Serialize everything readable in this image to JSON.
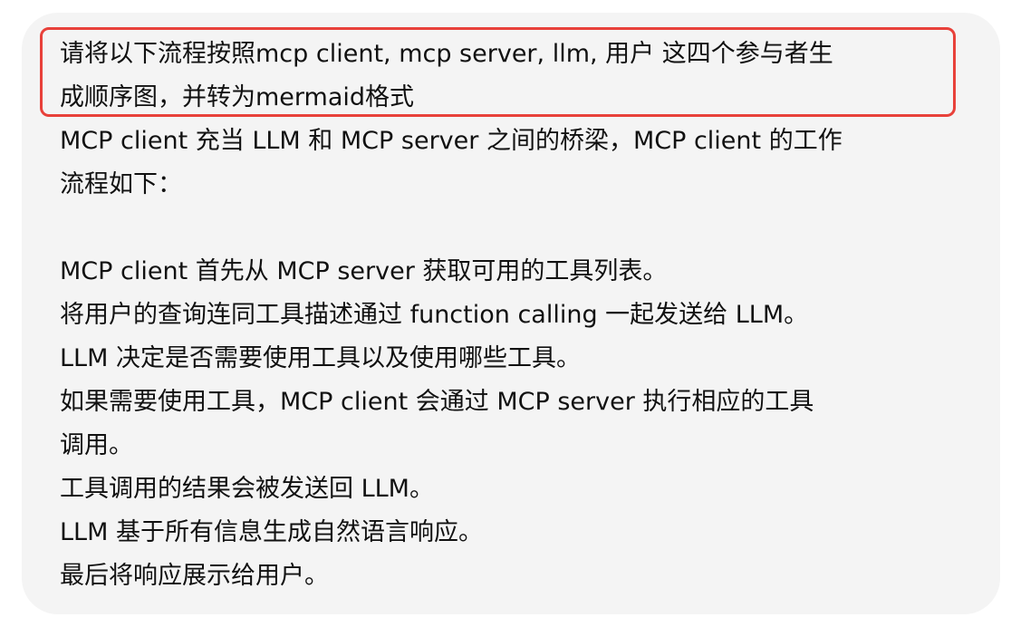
{
  "message": {
    "prompt_lines": [
      "请将以下流程按照mcp client, mcp server, llm, 用户 这四个参与者生",
      "成顺序图，并转为mermaid格式"
    ],
    "body_lines": [
      "MCP client 充当 LLM 和 MCP server 之间的桥梁，MCP client 的工作",
      "流程如下：",
      "",
      "MCP client 首先从 MCP server 获取可用的工具列表。",
      "将用户的查询连同工具描述通过 function calling 一起发送给 LLM。",
      "LLM 决定是否需要使用工具以及使用哪些工具。",
      "如果需要使用工具，MCP client 会通过 MCP server 执行相应的工具",
      "调用。",
      "工具调用的结果会被发送回 LLM。",
      "LLM 基于所有信息生成自然语言响应。",
      "最后将响应展示给用户。"
    ]
  },
  "colors": {
    "bubble_background": "#f4f4f4",
    "highlight_border": "#e8413a",
    "text": "#111111"
  }
}
